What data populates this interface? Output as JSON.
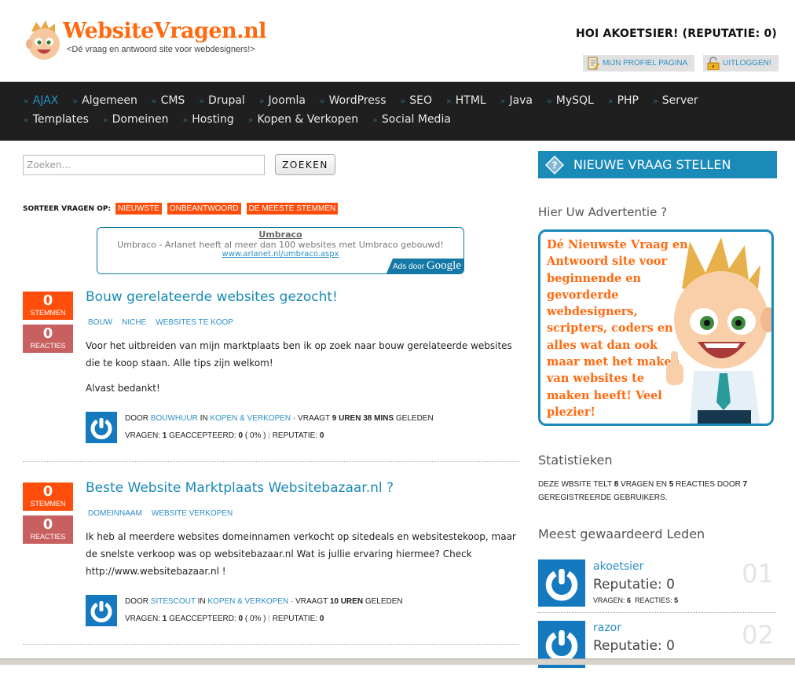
{
  "header": {
    "logo_title": "WebsiteVragen.nl",
    "logo_subtitle": "<Dé vraag en antwoord site voor webdesigners!>",
    "greeting": "HOI AKOETSIER! (REPUTATIE: 0)",
    "profile_button": "MIJN PROFIEL PAGINA",
    "logout_button": "UITLOGGEN!"
  },
  "nav": {
    "row1": [
      {
        "label": "AJAX",
        "active": true
      },
      {
        "label": "Algemeen"
      },
      {
        "label": "CMS"
      },
      {
        "label": "Drupal"
      },
      {
        "label": "Joomla"
      },
      {
        "label": "WordPress"
      },
      {
        "label": "SEO"
      },
      {
        "label": "HTML"
      },
      {
        "label": "Java"
      },
      {
        "label": "MySQL"
      },
      {
        "label": "PHP"
      },
      {
        "label": "Server"
      }
    ],
    "row2": [
      {
        "label": "Templates"
      },
      {
        "label": "Domeinen"
      },
      {
        "label": "Hosting"
      },
      {
        "label": "Kopen & Verkopen"
      },
      {
        "label": "Social Media"
      }
    ],
    "bullet": "»"
  },
  "search": {
    "placeholder": "Zoeken...",
    "value": "",
    "button": "ZOEKEN"
  },
  "sort": {
    "label": "SORTEER VRAGEN OP:",
    "options": [
      "NIEUWSTE",
      "ONBEANTWOORD",
      "DE MEESTE STEMMEN"
    ]
  },
  "ad": {
    "title": "Umbraco",
    "text": "Umbraco - Arlanet heeft al meer dan 100 websites met Umbraco gebouwd!",
    "url": "www.arlanet.nl/umbraco.aspx",
    "badge_prefix": "Ads door",
    "badge_brand": "Google"
  },
  "questions": [
    {
      "votes": "0",
      "votes_label": "STEMMEN",
      "replies": "0",
      "replies_label": "REACTIES",
      "title": "Bouw gerelateerde websites gezocht!",
      "tags": [
        "BOUW",
        "NICHE",
        "WEBSITES TE KOOP"
      ],
      "body": [
        "Voor het uitbreiden van mijn marktplaats ben ik op zoek naar bouw gerelateerde websites die te koop staan. Alle tips zijn welkom!",
        "Alvast bedankt!"
      ],
      "meta": {
        "by": "DOOR",
        "author": "BOUWHUUR",
        "in": "IN",
        "category": "KOPEN & VERKOPEN",
        "asked": "· VRAAGT",
        "age": "9 UREN 38 MINS",
        "ago": "GELEDEN",
        "questions_label": "VRAGEN:",
        "questions": "1",
        "accepted_label": "GEACCEPTEERD:",
        "accepted": "0",
        "accepted_pct": "( 0% )",
        "reputation_label": "REPUTATIE:",
        "reputation": "0"
      }
    },
    {
      "votes": "0",
      "votes_label": "STEMMEN",
      "replies": "0",
      "replies_label": "REACTIES",
      "title": "Beste Website Marktplaats Websitebazaar.nl ?",
      "tags": [
        "DOMEINNAAM",
        "WEBSITE VERKOPEN"
      ],
      "body": [
        "Ik heb al meerdere websites domeinnamen verkocht op sitedeals en websitestekoop, maar de snelste verkoop was op websitebazaar.nl Wat is jullie ervaring hiermee? Check http://www.websitebazaar.nl !"
      ],
      "meta": {
        "by": "DOOR",
        "author": "SITESCOUT",
        "in": "IN",
        "category": "KOPEN & VERKOPEN",
        "asked": "· VRAAGT",
        "age": "10 UREN",
        "ago": "GELEDEN",
        "questions_label": "VRAGEN:",
        "questions": "1",
        "accepted_label": "GEACCEPTEERD:",
        "accepted": "0",
        "accepted_pct": "( 0% )",
        "reputation_label": "REPUTATIE:",
        "reputation": "0"
      }
    }
  ],
  "sidebar": {
    "ask_button": "NIEUWE VRAAG STELLEN",
    "ad_heading": "Hier Uw Advertentie ?",
    "promo_text": "Dé Nieuwste Vraag en Antwoord site voor beginnende en gevorderde webdesigners, scripters, coders en alles wat dan ook maar met het maken van websites te maken heeft! Veel plezier!",
    "stats_heading": "Statistieken",
    "stats": {
      "prefix": "DEZE WBSITE TELT",
      "questions": "8",
      "mid1": "VRAGEN EN",
      "replies": "5",
      "mid2": "REACTIES DOOR",
      "users": "7",
      "suffix": "GEREGISTREERDE GEBRUIKERS."
    },
    "top_heading": "Meest gewaardeerd Leden",
    "members": [
      {
        "name": "akoetsier",
        "reputation": "Reputatie: 0",
        "questions_label": "VRAGEN:",
        "questions": "6",
        "replies_label": "REACTIES:",
        "replies": "5",
        "rank": "01"
      },
      {
        "name": "razor",
        "reputation": "Reputatie: 0",
        "rank": "02"
      }
    ]
  },
  "colors": {
    "brand_orange": "#ff6a10",
    "sort_orange": "#ff4e0c",
    "link_blue": "#2b8fc6",
    "accent_blue": "#1a8ab8",
    "nav_bg": "#1f1f1f",
    "replies_red": "#c96060"
  }
}
